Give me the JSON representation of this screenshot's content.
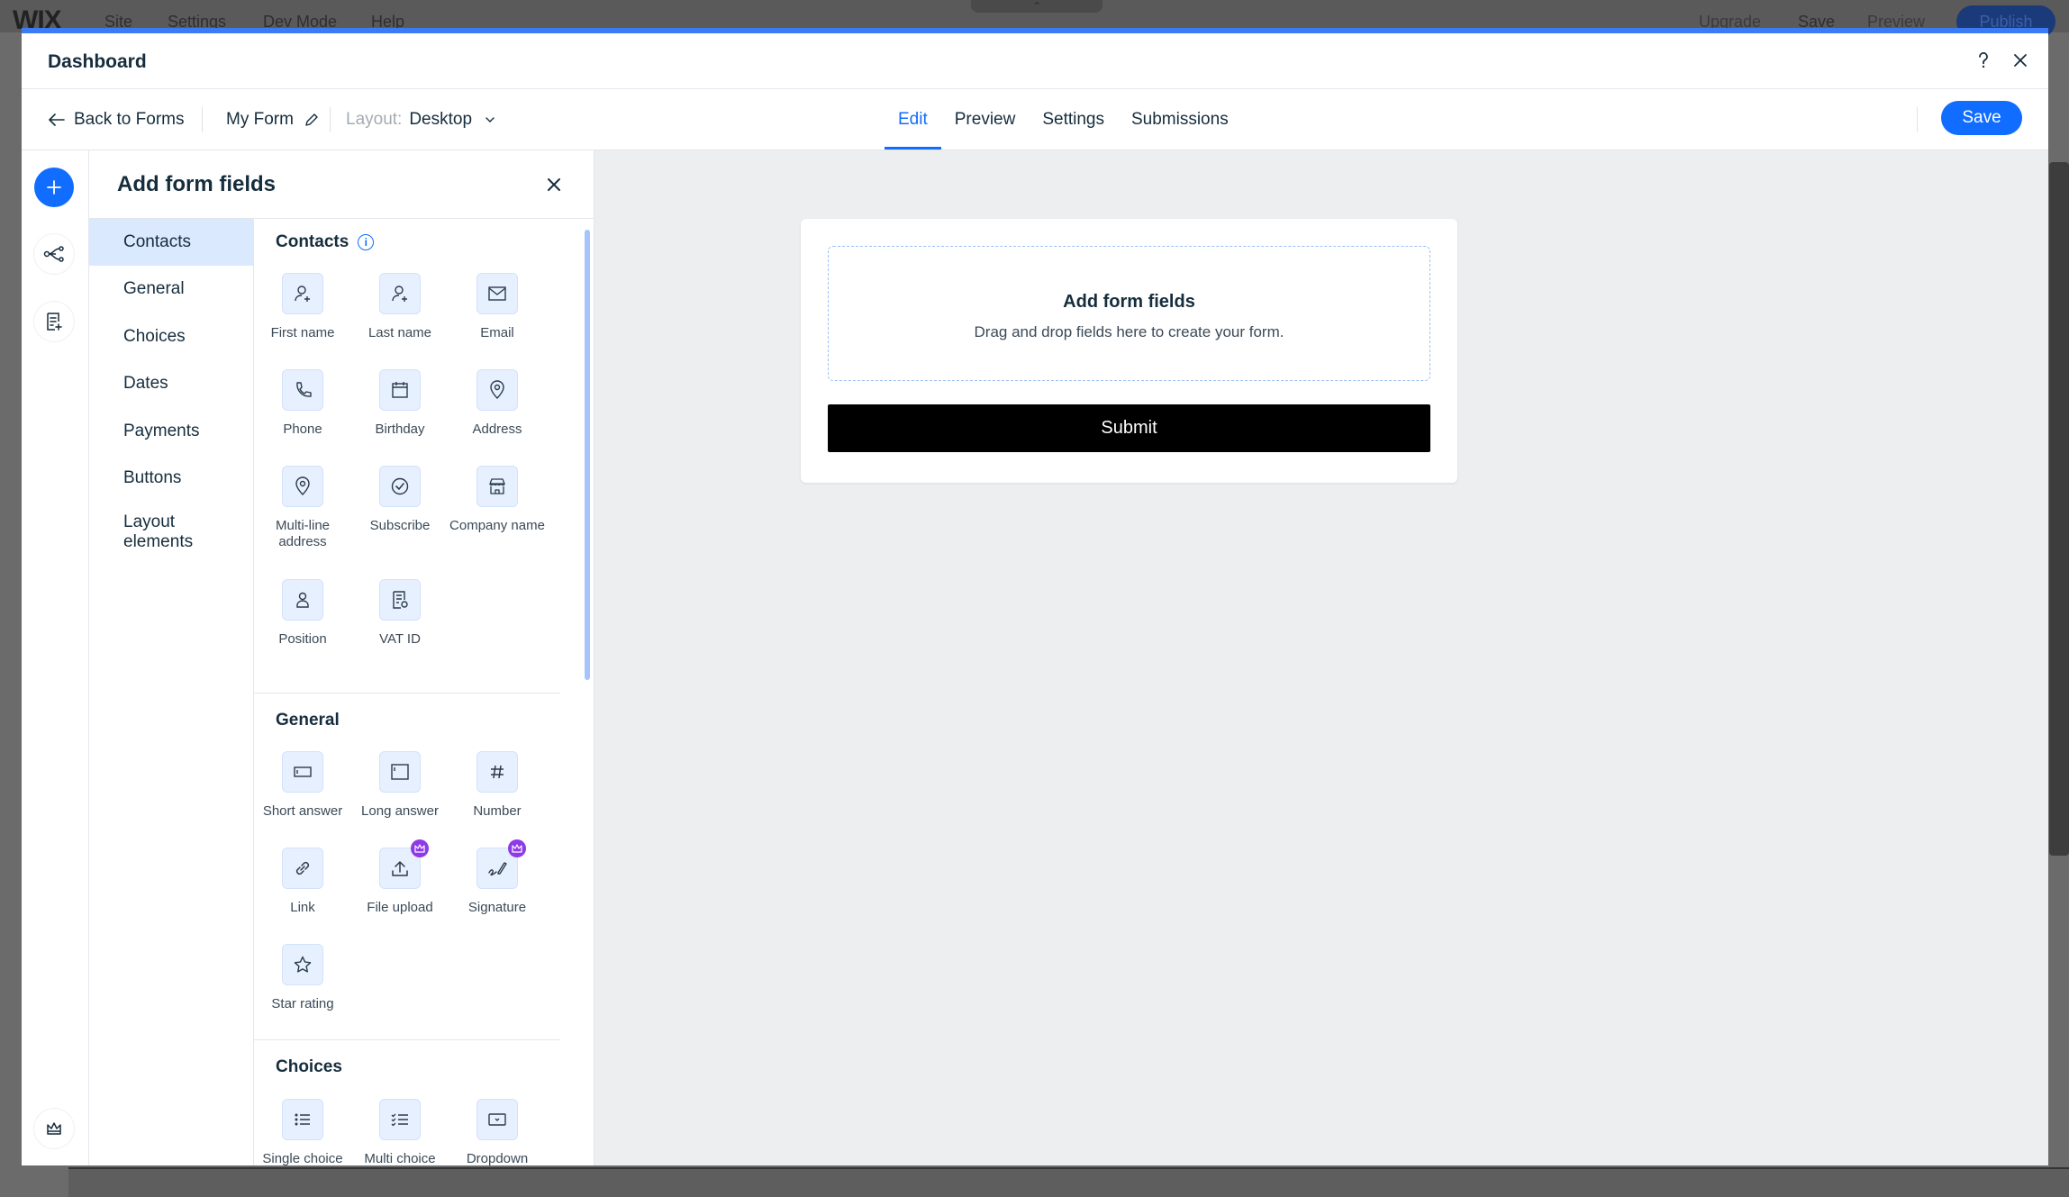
{
  "editor": {
    "logo": "WIX",
    "menu": [
      "Site",
      "Settings",
      "Dev Mode",
      "Help"
    ],
    "right_menu": [
      "Upgrade",
      "Save",
      "Preview"
    ],
    "publish": "Publish"
  },
  "modal": {
    "title": "Dashboard",
    "help_icon": "question-icon",
    "close_icon": "close-icon"
  },
  "toolbar": {
    "back_label": "Back to Forms",
    "form_name": "My Form",
    "layout_label": "Layout:",
    "layout_value": "Desktop",
    "tabs": [
      "Edit",
      "Preview",
      "Settings",
      "Submissions"
    ],
    "active_tab": "Edit",
    "save_label": "Save"
  },
  "panel": {
    "title": "Add form fields",
    "categories": [
      "Contacts",
      "General",
      "Choices",
      "Dates",
      "Payments",
      "Buttons",
      "Layout elements"
    ],
    "active_category": "Contacts",
    "sections": [
      {
        "title": "Contacts",
        "fields": [
          {
            "label": "First name",
            "icon": "person-icon"
          },
          {
            "label": "Last name",
            "icon": "person-icon"
          },
          {
            "label": "Email",
            "icon": "envelope-icon"
          },
          {
            "label": "Phone",
            "icon": "phone-icon"
          },
          {
            "label": "Birthday",
            "icon": "calendar-icon"
          },
          {
            "label": "Address",
            "icon": "location-pin-icon"
          },
          {
            "label": "Multi-line address",
            "icon": "location-pin-icon"
          },
          {
            "label": "Subscribe",
            "icon": "checkmark-circle-icon"
          },
          {
            "label": "Company name",
            "icon": "store-icon"
          },
          {
            "label": "Position",
            "icon": "person-badge-icon"
          },
          {
            "label": "VAT ID",
            "icon": "receipt-icon"
          }
        ]
      },
      {
        "title": "General",
        "fields": [
          {
            "label": "Short answer",
            "icon": "short-text-icon"
          },
          {
            "label": "Long answer",
            "icon": "long-text-icon"
          },
          {
            "label": "Number",
            "icon": "hash-icon"
          },
          {
            "label": "Link",
            "icon": "link-icon"
          },
          {
            "label": "File upload",
            "icon": "upload-icon",
            "premium": true
          },
          {
            "label": "Signature",
            "icon": "signature-icon",
            "premium": true
          },
          {
            "label": "Star rating",
            "icon": "star-icon"
          }
        ]
      },
      {
        "title": "Choices",
        "fields": [
          {
            "label": "Single choice",
            "icon": "list-icon"
          },
          {
            "label": "Multi choice",
            "icon": "checklist-icon"
          },
          {
            "label": "Dropdown",
            "icon": "dropdown-icon"
          }
        ]
      }
    ]
  },
  "canvas": {
    "dropzone_title": "Add form fields",
    "dropzone_subtitle": "Drag and drop fields here to create your form.",
    "submit_label": "Submit"
  },
  "colors": {
    "accent": "#116dff",
    "modal_top_border": "#3b7cf5",
    "active_category_bg": "#dbe9fe",
    "field_icon_bg": "#e7f0ff",
    "premium_badge": "#8f3ae8",
    "submit_bg": "#000000"
  }
}
